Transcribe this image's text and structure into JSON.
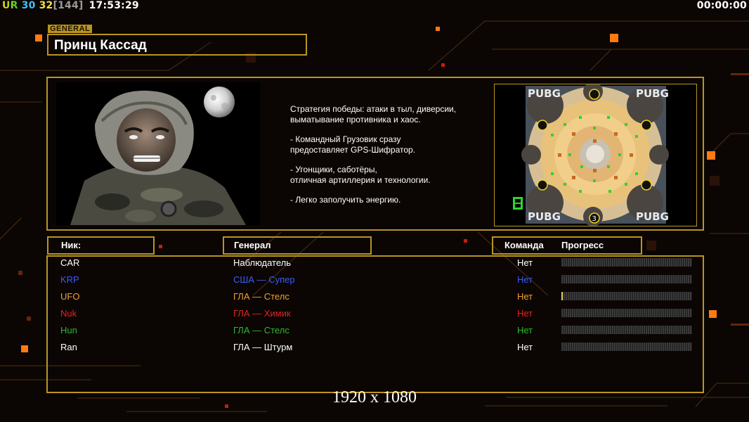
{
  "hud": {
    "ur_label": "UR",
    "fps": "30",
    "ping": "32",
    "ping_bracket": "[144]",
    "clock": "17:53:29",
    "timer": "00:00:00"
  },
  "general": {
    "tag": "GENERAL",
    "name": "Принц Кассад",
    "description": [
      "Стратегия победы: атаки в тыл, диверсии,\n выматывание противника и хаос.",
      "- Командный Грузовик сразу\nпредоставляет GPS-Шифратор.",
      "- Угонщики, саботёры,\nотличная артиллерия и технологии.",
      "- Легко заполучить энергию."
    ]
  },
  "map": {
    "corner_labels": [
      "PUBG",
      "PUBG",
      "PUBG",
      "PUBG"
    ],
    "spawn_number": "3"
  },
  "headers": {
    "nick": "Ник:",
    "general": "Генерал",
    "team": "Команда",
    "progress": "Прогресс"
  },
  "players": [
    {
      "nick": "CAR",
      "general": "Наблюдатель",
      "team": "Нет",
      "color": "#ffffff",
      "progress": 0
    },
    {
      "nick": "KRP",
      "general": "США — Супер",
      "team": "Нет",
      "color": "#3d5cf5",
      "progress": 0
    },
    {
      "nick": "UFO",
      "general": "ГЛА — Стелс",
      "team": "Нет",
      "color": "#f0a030",
      "progress": 0.01
    },
    {
      "nick": "Nuk",
      "general": "ГЛА — Химик",
      "team": "Нет",
      "color": "#e52222",
      "progress": 0
    },
    {
      "nick": "Hun",
      "general": "ГЛА — Стелс",
      "team": "Нет",
      "color": "#2fb82f",
      "progress": 0
    },
    {
      "nick": "Ran",
      "general": "ГЛА — Штурм",
      "team": "Нет",
      "color": "#ffffff",
      "progress": 0
    }
  ],
  "footer": {
    "resolution": "1920 x 1080"
  },
  "colors": {
    "accent": "#b9951f",
    "background": "#0b0604",
    "orange_glow": "#ff7a12"
  }
}
